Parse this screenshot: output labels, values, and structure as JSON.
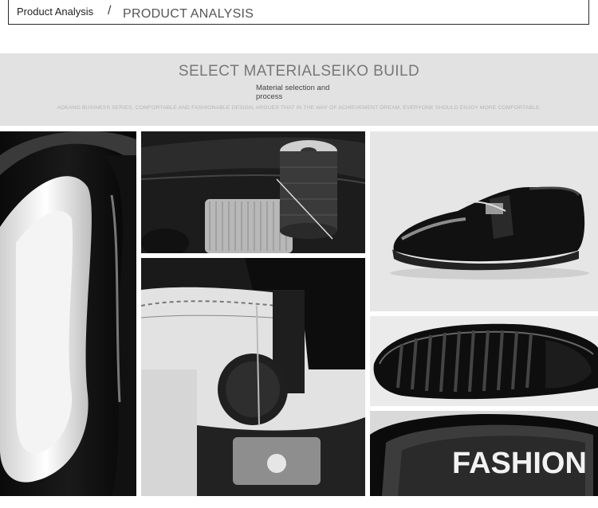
{
  "header": {
    "label_small": "Product Analysis",
    "separator": "/",
    "label_big": "PRODUCT ANALYSIS"
  },
  "banner": {
    "title": "SELECT MATERIALSEIKO BUILD",
    "subtitle": "Material selection and process",
    "body": "AOKANG BUSINESS SERIES, COMFORTABLE AND FASHIONABLE DESIGN, ARGUES THAT IN THE WAY OF ACHIEVEMENT DREAM, EVERYONE SHOULD ENJOY MORE COMFORTABLE."
  },
  "photos": {
    "insole_text": "FASHION"
  }
}
